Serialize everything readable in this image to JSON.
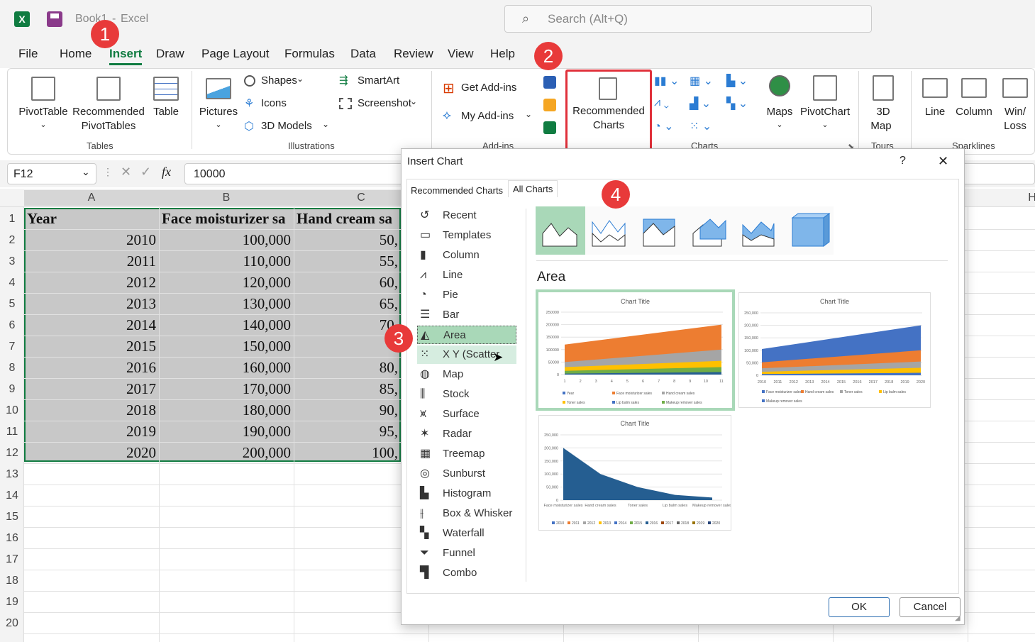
{
  "app": {
    "filename": "Book1",
    "separator": "-",
    "appname": "Excel"
  },
  "search": {
    "placeholder": "Search (Alt+Q)"
  },
  "menu": [
    "File",
    "Home",
    "Insert",
    "Draw",
    "Page Layout",
    "Formulas",
    "Data",
    "Review",
    "View",
    "Help"
  ],
  "ribbon": {
    "pivottable": "PivotTable",
    "recommended_pivottables": [
      "Recommended",
      "PivotTables"
    ],
    "table": "Table",
    "pictures": "Pictures",
    "shapes": "Shapes",
    "icons": "Icons",
    "models3d": "3D Models",
    "smartart": "SmartArt",
    "screenshot": "Screenshot",
    "get_addins": "Get Add-ins",
    "my_addins": "My Add-ins",
    "recommended_charts": [
      "Recommended",
      "Charts"
    ],
    "maps": "Maps",
    "pivotchart": "PivotChart",
    "map3d": [
      "3D",
      "Map"
    ],
    "line": "Line",
    "column": "Column",
    "winloss": [
      "Win/",
      "Loss"
    ],
    "groups": {
      "tables": "Tables",
      "illustrations": "Illustrations",
      "addins": "Add-ins",
      "charts": "Charts",
      "tours": "Tours",
      "sparklines": "Sparklines"
    }
  },
  "formula_bar": {
    "namebox": "F12",
    "fx": "fx",
    "value": "10000"
  },
  "columns": [
    "A",
    "B",
    "C",
    "H"
  ],
  "rows": [
    "1",
    "2",
    "3",
    "4",
    "5",
    "6",
    "7",
    "8",
    "9",
    "10",
    "11",
    "12",
    "13",
    "14",
    "15",
    "16",
    "17",
    "18",
    "19",
    "20"
  ],
  "sheet": {
    "header": [
      "Year",
      "Face moisturizer sa",
      "Hand cream sa"
    ],
    "data": [
      [
        "2010",
        "100,000",
        "50,"
      ],
      [
        "2011",
        "110,000",
        "55,"
      ],
      [
        "2012",
        "120,000",
        "60,"
      ],
      [
        "2013",
        "130,000",
        "65,"
      ],
      [
        "2014",
        "140,000",
        "70,"
      ],
      [
        "2015",
        "150,000",
        "7"
      ],
      [
        "2016",
        "160,000",
        "80,"
      ],
      [
        "2017",
        "170,000",
        "85,"
      ],
      [
        "2018",
        "180,000",
        "90,"
      ],
      [
        "2019",
        "190,000",
        "95,"
      ],
      [
        "2020",
        "200,000",
        "100,"
      ]
    ]
  },
  "dialog": {
    "title": "Insert Chart",
    "help": "?",
    "close": "✕",
    "tabs": [
      "Recommended Charts",
      "All Charts"
    ],
    "chart_types": [
      "Recent",
      "Templates",
      "Column",
      "Line",
      "Pie",
      "Bar",
      "Area",
      "X Y (Scatter)",
      "Map",
      "Stock",
      "Surface",
      "Radar",
      "Treemap",
      "Sunburst",
      "Histogram",
      "Box & Whisker",
      "Waterfall",
      "Funnel",
      "Combo"
    ],
    "section_title": "Area",
    "ok": "OK",
    "cancel": "Cancel",
    "preview1": {
      "title": "Chart Title",
      "yticks": [
        "250000",
        "200000",
        "150000",
        "100000",
        "50000",
        "0"
      ],
      "xticks": [
        "1",
        "2",
        "3",
        "4",
        "5",
        "6",
        "7",
        "8",
        "9",
        "10",
        "11"
      ],
      "legend": [
        "Year",
        "Face moisturizer sales",
        "Hand cream sales",
        "Toner sales",
        "Lip balm sales",
        "Makeup remover sales"
      ]
    },
    "preview2": {
      "title": "Chart Title",
      "yticks": [
        "250,000",
        "200,000",
        "150,000",
        "100,000",
        "50,000",
        "0"
      ],
      "xticks": [
        "2010",
        "2011",
        "2012",
        "2013",
        "2014",
        "2015",
        "2016",
        "2017",
        "2018",
        "2019",
        "2020"
      ],
      "legend": [
        "Face moisturizer sales",
        "Hand cream sales",
        "Toner sales",
        "Lip balm sales",
        "Makeup remover sales"
      ]
    },
    "preview3": {
      "title": "Chart Title",
      "yticks": [
        "250,000",
        "200,000",
        "150,000",
        "100,000",
        "50,000",
        "0"
      ],
      "xticks": [
        "Face moisturizer sales",
        "Hand cream sales",
        "Toner sales",
        "Lip balm sales",
        "Makeup remover sales"
      ],
      "legend": [
        "2010",
        "2011",
        "2012",
        "2013",
        "2014",
        "2015",
        "2016",
        "2017",
        "2018",
        "2019",
        "2020"
      ]
    }
  },
  "badges": [
    "1",
    "2",
    "3",
    "4"
  ],
  "colors": {
    "excel_green": "#107c41",
    "accent_red": "#e83a3a",
    "area_orange": "#ed7d31",
    "area_blue": "#4472c4",
    "area_gray": "#a5a5a5",
    "area_yellow": "#ffc000",
    "area_green": "#70ad47",
    "area_navy": "#255e91"
  }
}
